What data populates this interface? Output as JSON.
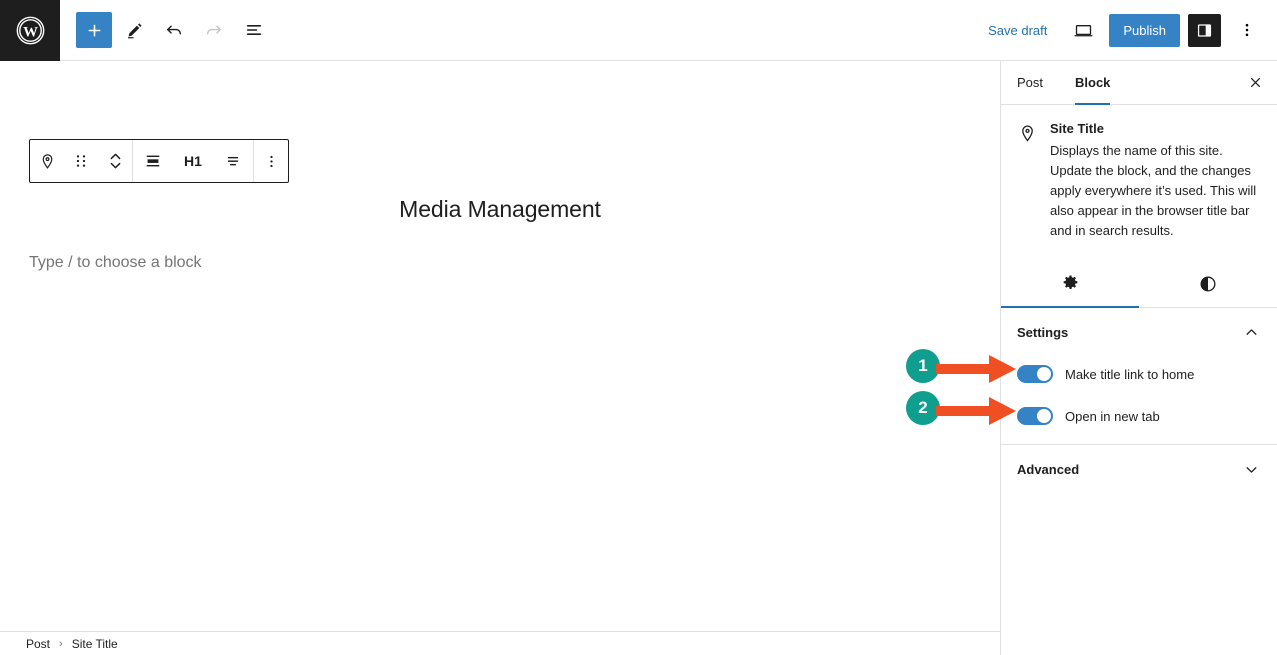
{
  "topbar": {
    "logo_icon": "wordpress-logo-icon",
    "add_block_icon": "plus-icon",
    "tools_icon": "pencil-icon",
    "undo_icon": "undo-arrow-icon",
    "redo_icon": "redo-arrow-icon",
    "list_view_icon": "list-view-icon",
    "save_draft_label": "Save draft",
    "preview_icon": "desktop-preview-icon",
    "publish_label": "Publish",
    "sidebar_toggle_icon": "settings-panel-icon",
    "options_icon": "kebab-menu-icon",
    "publish_color": "#3582c4",
    "link_color": "#2271b1"
  },
  "block_toolbar": {
    "block_type_icon": "map-pin-icon",
    "drag_icon": "drag-dots-icon",
    "move_icon": "move-up-down-icon",
    "align_icon": "align-block-icon",
    "heading_level_label": "H1",
    "text_align_icon": "text-align-icon",
    "more_options_icon": "kebab-menu-icon"
  },
  "canvas": {
    "post_title": "Media Management",
    "block_placeholder": "Type / to choose a block"
  },
  "breadcrumb": {
    "items": [
      "Post",
      "Site Title"
    ],
    "separator": "›"
  },
  "sidebar": {
    "tabs": [
      {
        "label": "Post",
        "active": false
      },
      {
        "label": "Block",
        "active": true
      }
    ],
    "close_icon": "close-icon",
    "block_card": {
      "icon": "map-pin-icon",
      "title": "Site Title",
      "description": "Displays the name of this site. Update the block, and the changes apply everywhere it’s used. This will also appear in the browser title bar and in search results."
    },
    "icon_tabs": [
      {
        "icon": "gear-icon",
        "name": "settings",
        "active": true
      },
      {
        "icon": "contrast-half-circle-icon",
        "name": "styles",
        "active": false
      }
    ],
    "settings_panel": {
      "title": "Settings",
      "chevron_icon": "chevron-up-icon",
      "toggles": [
        {
          "label": "Make title link to home",
          "on": true
        },
        {
          "label": "Open in new tab",
          "on": true
        }
      ]
    },
    "advanced_panel": {
      "title": "Advanced",
      "chevron_icon": "chevron-down-icon"
    },
    "toggle_on_color": "#3582c4",
    "active_tab_color": "#2271b1"
  },
  "annotations": {
    "badge_color": "#109e8e",
    "arrow_color": "#f04e23",
    "markers": [
      {
        "number": "1",
        "target": "Make title link to home"
      },
      {
        "number": "2",
        "target": "Open in new tab"
      }
    ]
  }
}
